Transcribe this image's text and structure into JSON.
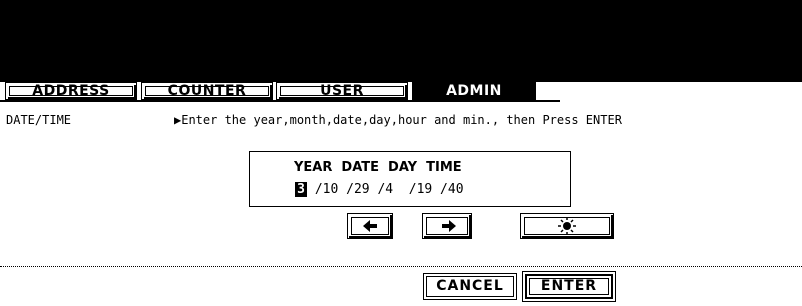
{
  "tabs": [
    {
      "label": "ADDRESS",
      "active": false
    },
    {
      "label": "COUNTER",
      "active": false
    },
    {
      "label": "USER",
      "active": false
    },
    {
      "label": "ADMIN",
      "active": true
    }
  ],
  "section_label": "DATE/TIME",
  "instruction": "▶Enter the year,month,date,day,hour and min., then Press ENTER",
  "panel": {
    "headers": "YEAR  DATE  DAY  TIME",
    "year": "3",
    "values_rest": "/10 /29 /4  /19 /40"
  },
  "icons": {
    "left": "arrow-left-icon",
    "right": "arrow-right-icon",
    "brightness": "brightness-icon"
  },
  "buttons": {
    "cancel": "CANCEL",
    "enter": "ENTER"
  }
}
